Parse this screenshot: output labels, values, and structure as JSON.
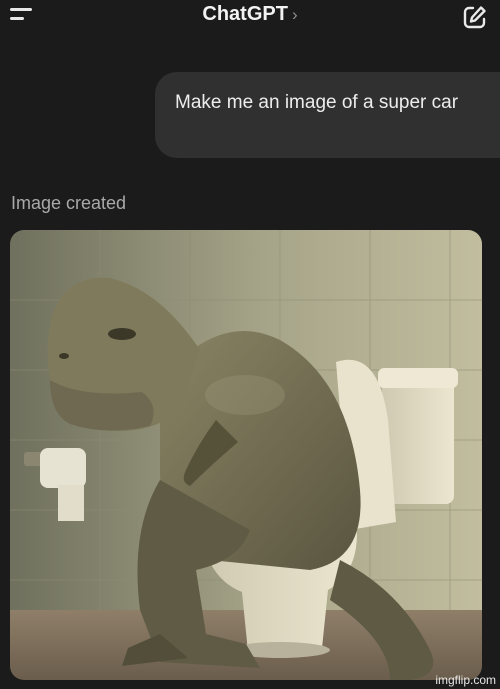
{
  "header": {
    "title": "ChatGPT",
    "title_chevron": "›",
    "menu_icon": "hamburger-menu-icon",
    "compose_icon": "new-chat-edit-icon"
  },
  "conversation": {
    "user_message": "Make me an image of a super car",
    "status_label": "Image created",
    "generated_image": {
      "subject": "dinosaur sitting on a toilet beside a toilet paper roll"
    }
  },
  "watermark": "imgflip.com",
  "colors": {
    "background": "#1b1b1b",
    "bubble": "#303030",
    "status_text": "#a9a9a9"
  }
}
